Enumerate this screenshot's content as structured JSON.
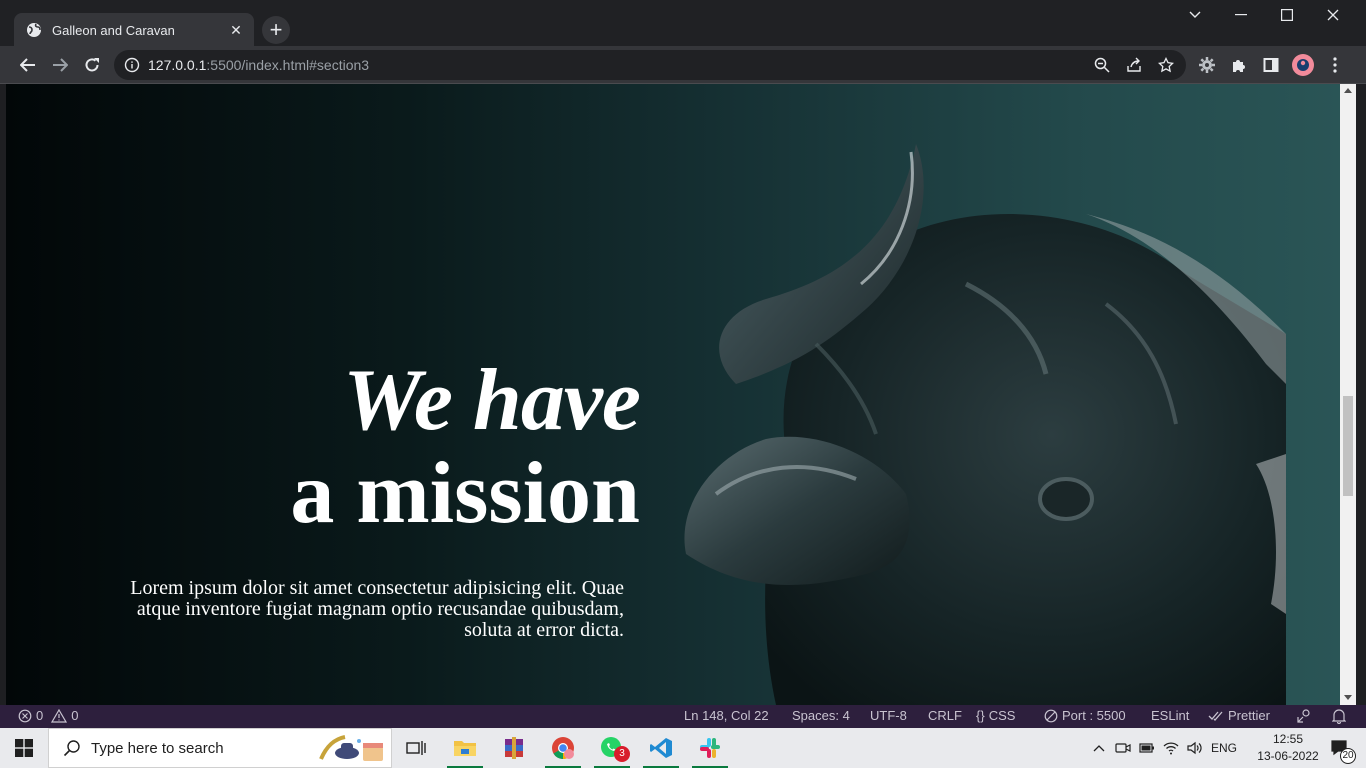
{
  "browser": {
    "tab_title": "Galleon and Caravan",
    "tab_close": "✕",
    "new_tab": "+",
    "url_host": "127.0.0.1",
    "url_rest": ":5500/index.html#section3"
  },
  "page": {
    "heading_line1": "We have",
    "heading_line2": "a mission",
    "lead": "Lorem ipsum dolor sit amet consectetur adipisicing elit. Quae atque inventore fugiat magnam optio recusandae quibusdam, soluta at error dicta."
  },
  "statusbar": {
    "errors": "0",
    "warnings": "0",
    "position": "Ln 148, Col 22",
    "spaces": "Spaces: 4",
    "encoding": "UTF-8",
    "eol": "CRLF",
    "language": "CSS",
    "port": "Port : 5500",
    "eslint": "ESLint",
    "prettier": "Prettier"
  },
  "taskbar": {
    "search_placeholder": "Type here to search",
    "whatsapp_badge": "3",
    "language": "ENG",
    "time": "12:55",
    "date": "13-06-2022",
    "notifications": "20"
  },
  "colors": {
    "hero_dark": "#020708",
    "hero_light": "#2a5556",
    "statusbar_bg": "#2d1f3d",
    "taskbar_bg": "#e9eaed"
  }
}
